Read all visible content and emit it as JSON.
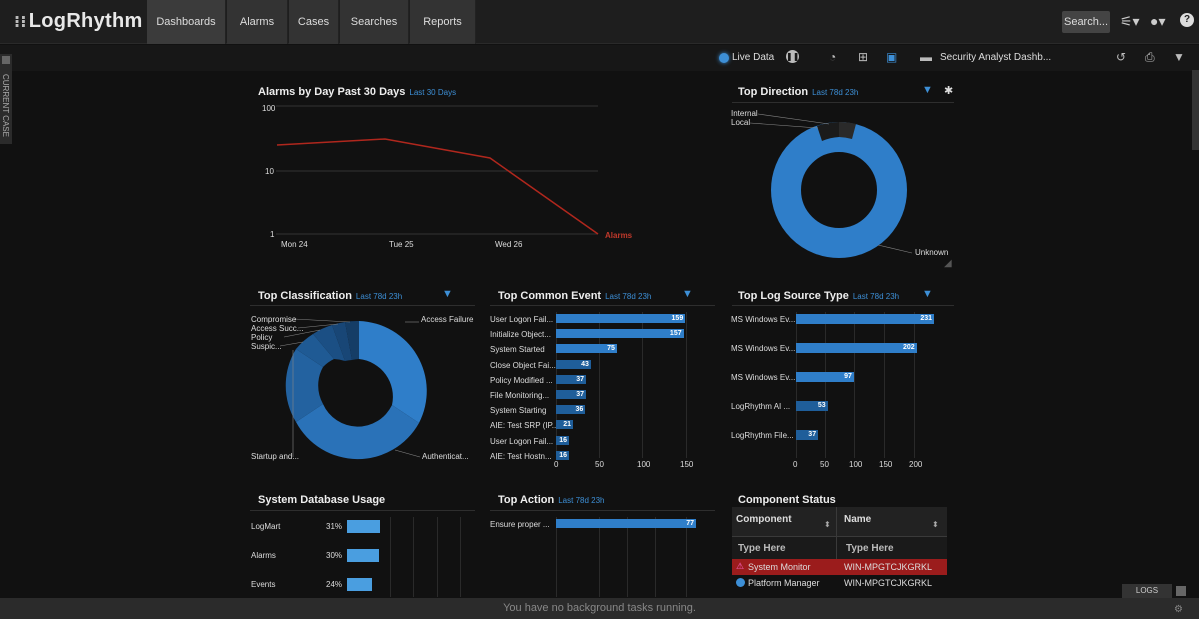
{
  "nav": {
    "logo": "LogRhythm",
    "tabs": [
      "Dashboards",
      "Alarms",
      "Cases",
      "Searches",
      "Reports"
    ],
    "search_label": "Search..."
  },
  "subbar": {
    "live_label": "Live Data",
    "dashboard_name": "Security Analyst Dashb..."
  },
  "sidebar": {
    "current_case_label": "CURRENT CASE"
  },
  "alarms_widget": {
    "title": "Alarms by Day Past 30 Days",
    "subtitle": "Last 30 Days",
    "series_label": "Alarms",
    "y_ticks": [
      "100",
      "10",
      "1"
    ],
    "x_ticks": [
      "Mon 24",
      "Tue 25",
      "Wed 26"
    ],
    "color": "#c0392b"
  },
  "direction_widget": {
    "title": "Top Direction",
    "subtitle": "Last 78d 23h",
    "labels": [
      "Internal",
      "Local",
      "Unknown"
    ]
  },
  "classification_widget": {
    "title": "Top Classification",
    "subtitle": "Last 78d 23h",
    "labels": [
      "Compromise",
      "Access Succ...",
      "Policy",
      "Suspic...",
      "Access Failure",
      "Authenticat...",
      "Startup and..."
    ]
  },
  "common_event_widget": {
    "title": "Top Common Event",
    "subtitle": "Last 78d 23h",
    "items": [
      {
        "label": "User Logon Fail...",
        "value": "159",
        "frac": 0.9297
      },
      {
        "label": "Initialize Object...",
        "value": "157",
        "frac": 0.9181
      },
      {
        "label": "System Started",
        "value": "75",
        "frac": 0.4386
      },
      {
        "label": "Close Object Fai...",
        "value": "43",
        "frac": 0.2515
      },
      {
        "label": "Policy Modified ...",
        "value": "37",
        "frac": 0.2164
      },
      {
        "label": "File Monitoring...",
        "value": "37",
        "frac": 0.2164
      },
      {
        "label": "System Starting",
        "value": "36",
        "frac": 0.2105
      },
      {
        "label": "AIE: Test SRP (IP...",
        "value": "21",
        "frac": 0.1228
      },
      {
        "label": "User Logon Fail...",
        "value": "16",
        "frac": 0.0936
      },
      {
        "label": "AIE: Test Hostn...",
        "value": "16",
        "frac": 0.0936
      }
    ],
    "axis": [
      "0",
      "50",
      "100",
      "150"
    ]
  },
  "log_source_widget": {
    "title": "Top Log Source Type",
    "subtitle": "Last 78d 23h",
    "items": [
      {
        "label": "MS Windows Ev...",
        "value": "231",
        "frac": 1.0
      },
      {
        "label": "MS Windows Ev...",
        "value": "202",
        "frac": 0.8745
      },
      {
        "label": "MS Windows Ev...",
        "value": "97",
        "frac": 0.4199
      },
      {
        "label": "LogRhythm AI ...",
        "value": "53",
        "frac": 0.2294
      },
      {
        "label": "LogRhythm File...",
        "value": "37",
        "frac": 0.1602
      }
    ],
    "axis": [
      "0",
      "50",
      "100",
      "150",
      "200"
    ]
  },
  "db_usage_widget": {
    "title": "System Database Usage",
    "items": [
      {
        "label": "LogMart",
        "value": "31%",
        "frac": 0.31
      },
      {
        "label": "Alarms",
        "value": "30%",
        "frac": 0.3
      },
      {
        "label": "Events",
        "value": "24%",
        "frac": 0.24
      }
    ]
  },
  "action_widget": {
    "title": "Top Action",
    "subtitle": "Last 78d 23h",
    "items": [
      {
        "label": "Ensure proper ...",
        "value": "77",
        "frac": 1.0
      }
    ]
  },
  "component_widget": {
    "title": "Component Status",
    "col_component": "Component",
    "col_name": "Name",
    "filter_placeholder": "Type Here",
    "rows": [
      {
        "component": "System Monitor",
        "name": "WIN-MPGTCJKGRKL",
        "alert": true
      },
      {
        "component": "Platform Manager",
        "name": "WIN-MPGTCJKGRKL",
        "alert": false
      }
    ]
  },
  "footer": {
    "background_tasks": "You have no background tasks running.",
    "logs_label": "LOGS"
  }
}
